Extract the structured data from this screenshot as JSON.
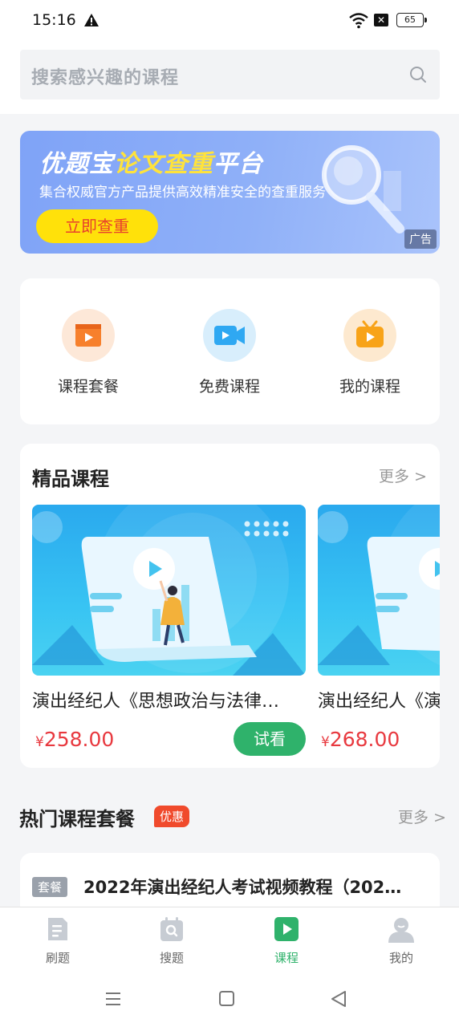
{
  "status_bar": {
    "time": "15:16",
    "battery": "65"
  },
  "search": {
    "placeholder": "搜索感兴趣的课程"
  },
  "banner": {
    "title_part1": "优题宝",
    "title_highlight": "论文查重",
    "title_part2": "平台",
    "subtitle": "集合权威官方产品提供高效精准安全的查重服务",
    "button_label": "立即查重",
    "ad_label": "广告"
  },
  "quick_menu": [
    {
      "label": "课程套餐",
      "icon": "video-card-icon",
      "color": "#f7802c"
    },
    {
      "label": "免费课程",
      "icon": "camera-icon",
      "color": "#2fa8f2"
    },
    {
      "label": "我的课程",
      "icon": "tv-icon",
      "color": "#f8a318"
    }
  ],
  "premium": {
    "title": "精品课程",
    "more": "更多 >",
    "courses": [
      {
        "title": "演出经纪人《思想政治与法律…",
        "currency": "¥",
        "price": "258.00",
        "action": "试看"
      },
      {
        "title": "演出经纪人《演出市场政策与经纪实务》",
        "currency": "¥",
        "price": "268.00"
      }
    ]
  },
  "hot": {
    "title": "热门课程套餐",
    "badge": "优惠",
    "more": "更多 >",
    "package_tag": "套餐",
    "package_title": "2022年演出经纪人考试视频教程（202…"
  },
  "tabbar": {
    "tabs": [
      {
        "label": "刷题",
        "icon": "document-icon"
      },
      {
        "label": "搜题",
        "icon": "search-calendar-icon"
      },
      {
        "label": "课程",
        "icon": "play-icon",
        "active": true
      },
      {
        "label": "我的",
        "icon": "user-icon"
      }
    ],
    "active_color": "#2fb26b"
  }
}
